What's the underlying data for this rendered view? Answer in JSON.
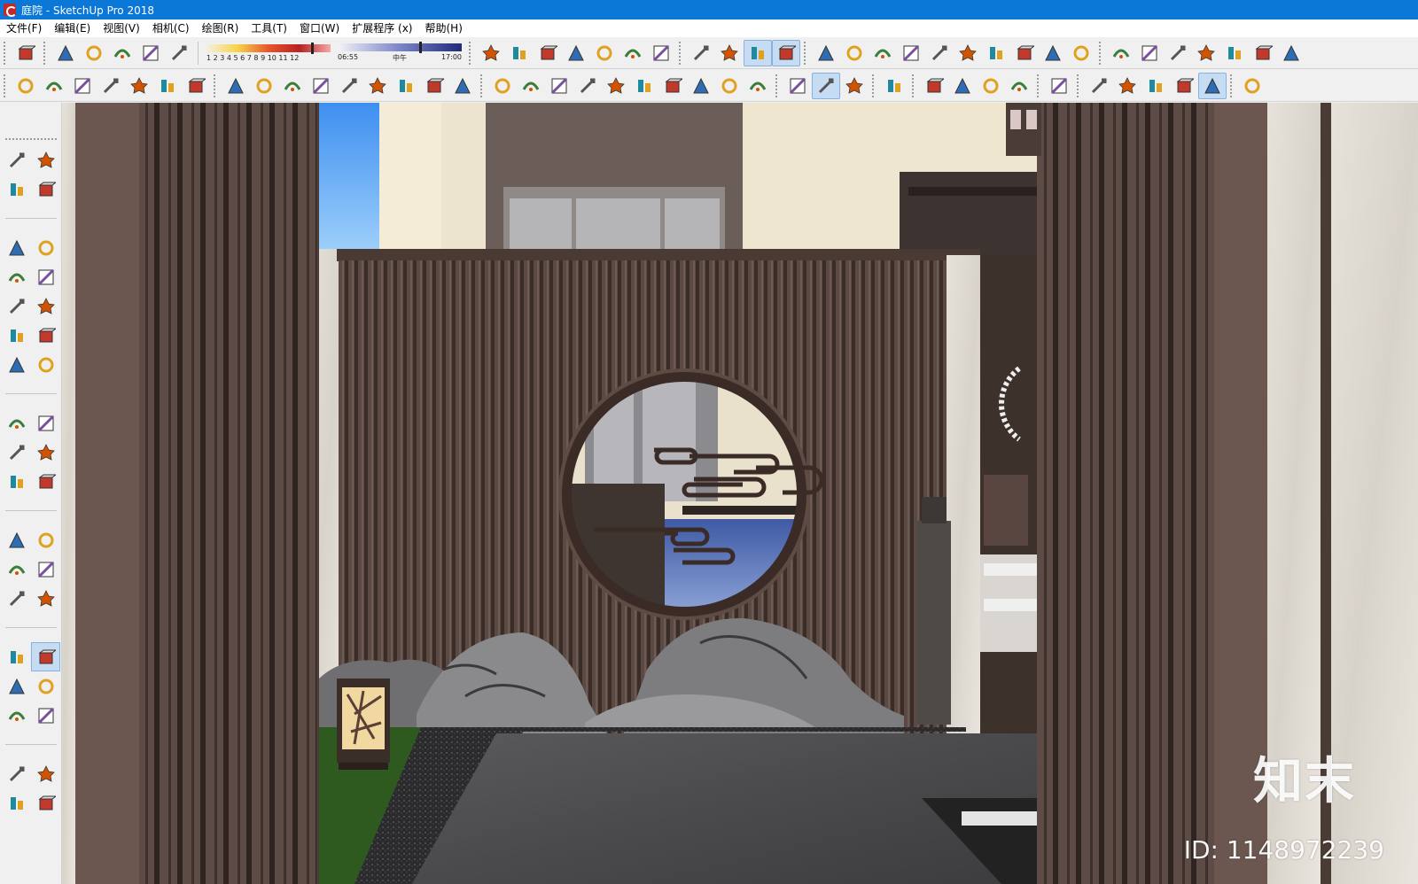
{
  "window": {
    "title": "庭院 - SketchUp Pro 2018"
  },
  "menu": [
    {
      "label": "文件(F)"
    },
    {
      "label": "编辑(E)"
    },
    {
      "label": "视图(V)"
    },
    {
      "label": "相机(C)"
    },
    {
      "label": "绘图(R)"
    },
    {
      "label": "工具(T)"
    },
    {
      "label": "窗口(W)"
    },
    {
      "label": "扩展程序 (x)"
    },
    {
      "label": "帮助(H)"
    }
  ],
  "shadow": {
    "months": "1 2 3 4 5 6 7 8 9 10 11 12",
    "time_start": "06:55",
    "time_mid": "中午",
    "time_end": "17:00"
  },
  "toolbar1_icons": [
    "layers-icon",
    "iso-view-icon",
    "top-view-icon",
    "front-view-icon",
    "right-view-icon",
    "back-view-icon",
    "section-fill-icon",
    "sandbox-smoove-icon",
    "sandbox-stamp-icon",
    "sandbox-drape-icon",
    "sandbox-add-detail-icon",
    "sandbox-flip-edge-icon",
    "sandbox-from-contours-icon",
    "orbit-target-icon",
    "warehouse-cube-icon",
    "component-cube-icon",
    "extension-cube-icon",
    "surface-icon",
    "curve-loft-icon",
    "fan-surface-icon",
    "sweep-icon",
    "fold-icon",
    "tangent-icon",
    "shell-icon",
    "pipe-icon",
    "pipe-bend-icon",
    "mesh-icon",
    "frame-icon",
    "house-3d-icon",
    "door-icon",
    "home-icon",
    "box-open-icon",
    "house-outline-icon",
    "garage-icon"
  ],
  "toolbar2_icons": [
    "push-tool-icon",
    "copy-tool-icon",
    "frame-tool-icon",
    "grid-tool-icon",
    "fence-tool-icon",
    "stair-tool-icon",
    "rail-tool-icon",
    "line-check-icon",
    "bezier-icon",
    "polyline-icon",
    "curve-edit-icon",
    "erase-line-icon",
    "offset-icon",
    "chain-icon",
    "arc-tool-icon",
    "red-arrow-icon",
    "box-3d-icon",
    "grow-icon",
    "push-down-icon",
    "bend-icon",
    "fillet-icon",
    "array-icon",
    "labels-icon",
    "tools-kit-icon",
    "pin-icon",
    "pen-icon",
    "ib-icon",
    "cleanup-icon",
    "su-app-icon",
    "road-icon",
    "dot-icon",
    "cone-icon",
    "line-icon",
    "square-icon",
    "hide-icon",
    "plugin-p-icon",
    "orbit-gear-icon",
    "screen-icon",
    "camera-icon",
    "vr-icon",
    "flower-gear-icon"
  ],
  "left_tools": [
    "select-arrow-icon",
    "component-make-icon",
    "paint-bucket-icon",
    "eraser-icon",
    "line-pencil-icon",
    "freehand-icon",
    "rectangle-icon",
    "rotated-rectangle-icon",
    "circle-icon",
    "polygon-icon",
    "arc-icon",
    "two-point-arc-icon",
    "three-point-arc-icon",
    "pie-icon",
    "move-icon",
    "push-pull-icon",
    "rotate-icon",
    "follow-me-icon",
    "scale-icon",
    "offset-tool-icon",
    "tape-measure-icon",
    "dimension-icon",
    "protractor-icon",
    "text-label-icon",
    "axes-icon",
    "3d-text-icon",
    "orbit-icon",
    "pan-hand-icon",
    "zoom-icon",
    "zoom-window-icon",
    "zoom-extents-icon",
    "previous-view-icon",
    "position-camera-icon",
    "look-around-icon",
    "walk-icon",
    "section-plane-icon"
  ],
  "watermark": {
    "logo": "知末",
    "id": "ID: 1148972239"
  }
}
